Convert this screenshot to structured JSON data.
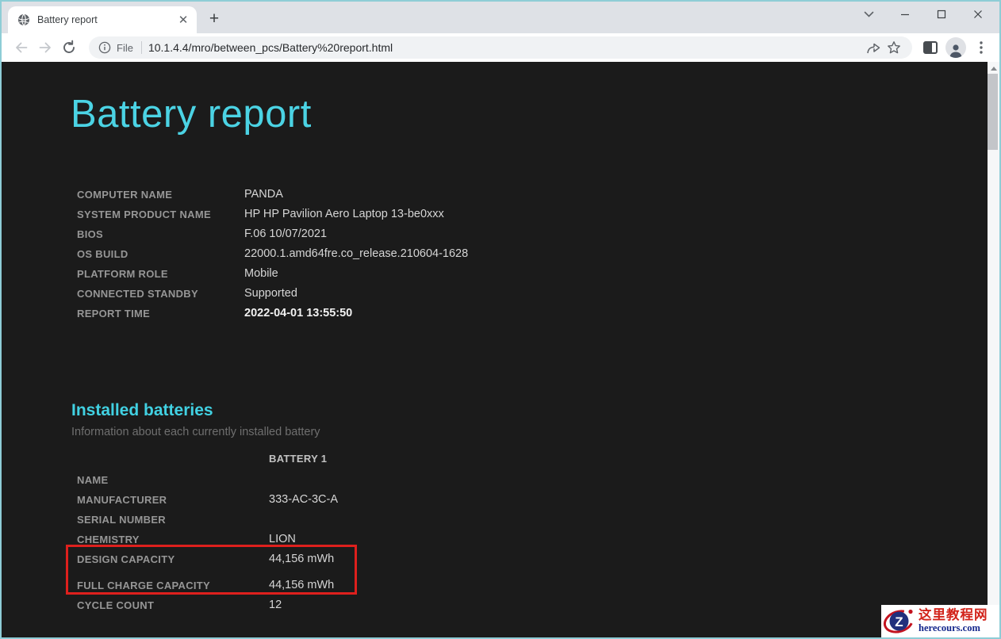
{
  "browser": {
    "tab_title": "Battery report",
    "address": {
      "scheme_label": "File",
      "url": "10.1.4.4/mro/between_pcs/Battery%20report.html"
    }
  },
  "page": {
    "title": "Battery report",
    "system_info": {
      "rows": [
        {
          "label": "COMPUTER NAME",
          "value": "PANDA"
        },
        {
          "label": "SYSTEM PRODUCT NAME",
          "value": "HP HP Pavilion Aero Laptop 13-be0xxx"
        },
        {
          "label": "BIOS",
          "value": "F.06 10/07/2021"
        },
        {
          "label": "OS BUILD",
          "value": "22000.1.amd64fre.co_release.210604-1628"
        },
        {
          "label": "PLATFORM ROLE",
          "value": "Mobile"
        },
        {
          "label": "CONNECTED STANDBY",
          "value": "Supported"
        },
        {
          "label": "REPORT TIME",
          "value": "2022-04-01  13:55:50"
        }
      ]
    },
    "installed_batteries": {
      "heading": "Installed batteries",
      "subtitle": "Information about each currently installed battery",
      "column_header": "BATTERY 1",
      "rows": [
        {
          "label": "NAME",
          "value": ""
        },
        {
          "label": "MANUFACTURER",
          "value": "333-AC-3C-A"
        },
        {
          "label": "SERIAL NUMBER",
          "value": ""
        },
        {
          "label": "CHEMISTRY",
          "value": "LION"
        },
        {
          "label": "DESIGN CAPACITY",
          "value": "44,156 mWh"
        },
        {
          "label": "FULL CHARGE CAPACITY",
          "value": "44,156 mWh"
        },
        {
          "label": "CYCLE COUNT",
          "value": "12"
        }
      ],
      "highlighted_rows": [
        "DESIGN CAPACITY",
        "FULL CHARGE CAPACITY"
      ]
    }
  },
  "watermark": {
    "site_name": "这里教程网",
    "site_domain": "herecours.com",
    "logo_letter": "Z"
  },
  "colors": {
    "page_background": "#1b1b1b",
    "heading_accent": "#41d1e2",
    "label_gray": "#969696",
    "value_gray": "#d6d6d6",
    "highlight_red": "#de201d",
    "window_border_teal": "#8ecdd6",
    "tabbar_gray": "#dee1e6",
    "watermark_red": "#d2231a",
    "watermark_navy": "#14278c"
  }
}
